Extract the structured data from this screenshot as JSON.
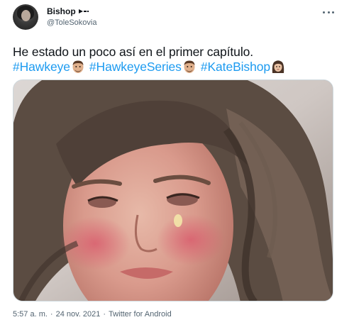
{
  "author": {
    "name": "Bishop",
    "handle": "@ToleSokovia"
  },
  "tweet": {
    "text": "He estado un poco así en el primer capítulo.",
    "hashtags": [
      "#Hawkeye",
      "#HawkeyeSeries",
      "#KateBishop"
    ]
  },
  "meta": {
    "time": "5:57 a. m.",
    "separator": "·",
    "date": "24 nov. 2021",
    "source": "Twitter for Android"
  },
  "icons": {
    "name_badge": "arrow-icon",
    "more": "more-icon",
    "hashtag_emoji": "hawkeye-emoji",
    "kate_emoji": "kate-bishop-emoji"
  },
  "colors": {
    "link": "#1d9bf0",
    "muted": "#536471",
    "text": "#0f1419"
  }
}
